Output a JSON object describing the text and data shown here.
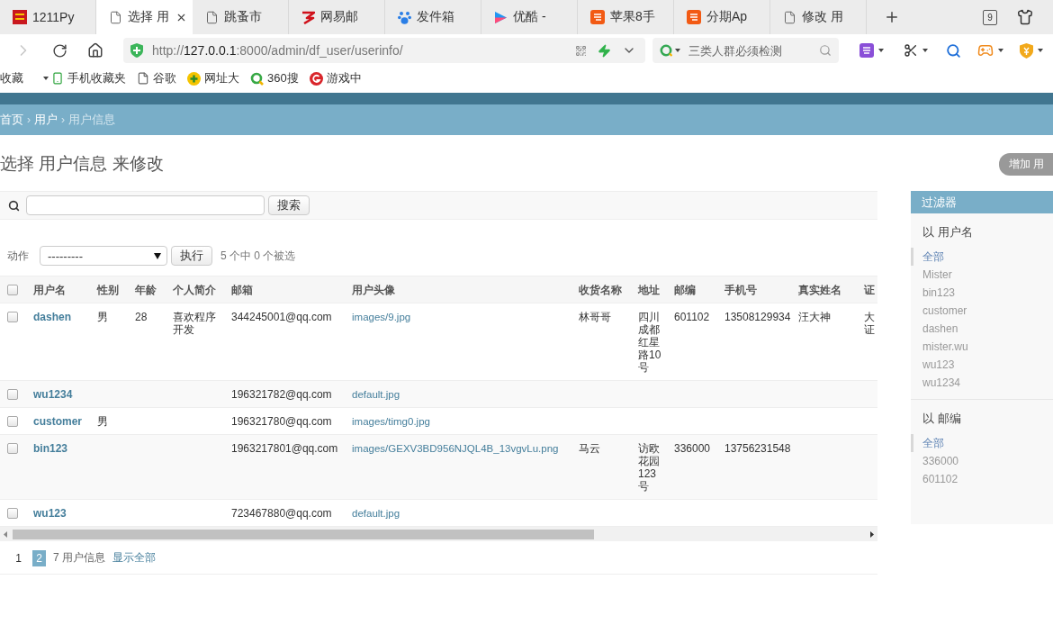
{
  "browser": {
    "tabs": [
      {
        "title": "1211Py",
        "kind": "app",
        "selected": false
      },
      {
        "title": "选择 用",
        "kind": "page",
        "selected": true
      },
      {
        "title": "跳蚤市",
        "kind": "page",
        "selected": false
      },
      {
        "title": "网易邮",
        "kind": "zigzag",
        "selected": false
      },
      {
        "title": "发件箱",
        "kind": "paw",
        "selected": false
      },
      {
        "title": "优酷 -",
        "kind": "play",
        "selected": false
      },
      {
        "title": "苹果8手",
        "kind": "tile",
        "selected": false
      },
      {
        "title": "分期Ap",
        "kind": "tile",
        "selected": false
      },
      {
        "title": "修改 用",
        "kind": "page",
        "selected": false
      }
    ],
    "tab_count": "9",
    "forward_disabled": true,
    "address": {
      "scheme": "http://",
      "host": "127.0.0.1",
      "path": ":8000/admin/df_user/userinfo/"
    },
    "search_placeholder": "三类人群必须检测",
    "bookmarks": [
      {
        "label": "收藏",
        "kind": "menu"
      },
      {
        "label": "手机收藏夹",
        "kind": "phone"
      },
      {
        "label": "谷歌",
        "kind": "page"
      },
      {
        "label": "网址大",
        "kind": "plus"
      },
      {
        "label": "360搜",
        "kind": "ring"
      },
      {
        "label": "游戏中",
        "kind": "round"
      }
    ]
  },
  "admin": {
    "breadcrumbs": [
      {
        "label": "首页",
        "kind": "link"
      },
      {
        "separator": "›",
        "label": "用户",
        "kind": "link"
      },
      {
        "separator": "›",
        "label": "用户信息",
        "kind": "current"
      }
    ],
    "title": "选择 用户信息 来修改",
    "add_button": "增加 用",
    "search": {
      "button": "搜索"
    },
    "actions": {
      "label": "动作",
      "value": "---------",
      "run_button": "执行",
      "counter": "5 个中 0 个被选"
    },
    "table": {
      "select_all_checked": false,
      "columns": [
        "用户名",
        "性别",
        "年龄",
        "个人简介",
        "邮箱",
        "用户头像",
        "收货名称",
        "地址",
        "邮编",
        "手机号",
        "真实姓名",
        "证"
      ],
      "rows": [
        {
          "checked": false,
          "username": "dashen",
          "gender": "男",
          "age": "28",
          "bio": "喜欢程序开发",
          "email": "344245001@qq.com",
          "avatar": "images/9.jpg",
          "recipient": "林哥哥",
          "address": "四川成都红星路10号",
          "postcode": "601102",
          "phone": "13508129934",
          "real_name": "汪大神",
          "column_12": "大证"
        },
        {
          "checked": false,
          "username": "wu1234",
          "email": "196321782@qq.com",
          "avatar": "default.jpg"
        },
        {
          "checked": false,
          "username": "customer",
          "gender": "男",
          "email": "196321780@qq.com",
          "avatar": "images/timg0.jpg"
        },
        {
          "checked": false,
          "username": "bin123",
          "email": "1963217801@qq.com",
          "avatar": "images/GEXV3BD956NJQL4B_13vgvLu.png",
          "recipient": "马云",
          "address": "访欧花园123号",
          "postcode": "336000",
          "phone": "13756231548"
        },
        {
          "checked": false,
          "username": "wu123",
          "email": "723467880@qq.com",
          "avatar": "default.jpg"
        }
      ]
    },
    "pagination": {
      "pages": [
        {
          "label": "1",
          "selected": false
        },
        {
          "label": "2",
          "selected": true
        }
      ],
      "count": "7 用户信息",
      "show_all": "显示全部"
    },
    "filter": {
      "title": "过滤器",
      "groups": [
        {
          "title": "以 用户名",
          "options": [
            {
              "label": "全部",
              "selected": true
            },
            {
              "label": "Mister",
              "selected": false
            },
            {
              "label": "bin123",
              "selected": false
            },
            {
              "label": "customer",
              "selected": false
            },
            {
              "label": "dashen",
              "selected": false
            },
            {
              "label": "mister.wu",
              "selected": false
            },
            {
              "label": "wu123",
              "selected": false
            },
            {
              "label": "wu1234",
              "selected": false
            }
          ]
        },
        {
          "title": "以 邮编",
          "options": [
            {
              "label": "全部",
              "selected": true
            },
            {
              "label": "336000",
              "selected": false
            },
            {
              "label": "601102",
              "selected": false
            }
          ]
        }
      ]
    }
  }
}
